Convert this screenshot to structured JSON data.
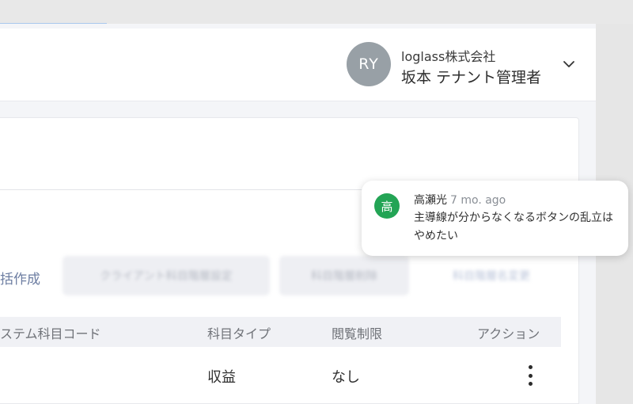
{
  "header": {
    "avatar_initials": "RY",
    "company": "loglass株式会社",
    "user_name": "坂本 テナント管理者"
  },
  "toolbar": {
    "create_link": "括作成",
    "button_1": "クライアント科目階層設定",
    "button_2": "科目階層削除",
    "button_3": "科目階層名変更"
  },
  "table": {
    "columns": [
      "システム科目コード",
      "科目タイプ",
      "閲覧制限",
      "アクション"
    ],
    "rows": [
      {
        "type": "収益",
        "view_restriction": "なし"
      }
    ]
  },
  "comment": {
    "avatar_char": "高",
    "author": "高瀬光",
    "time": "7 mo. ago",
    "text": "主導線が分からなくなるボタンの乱立はやめたい"
  },
  "colors": {
    "comment_avatar": "#23a455",
    "user_avatar": "#98a0a6",
    "link": "#6d7ea2"
  }
}
